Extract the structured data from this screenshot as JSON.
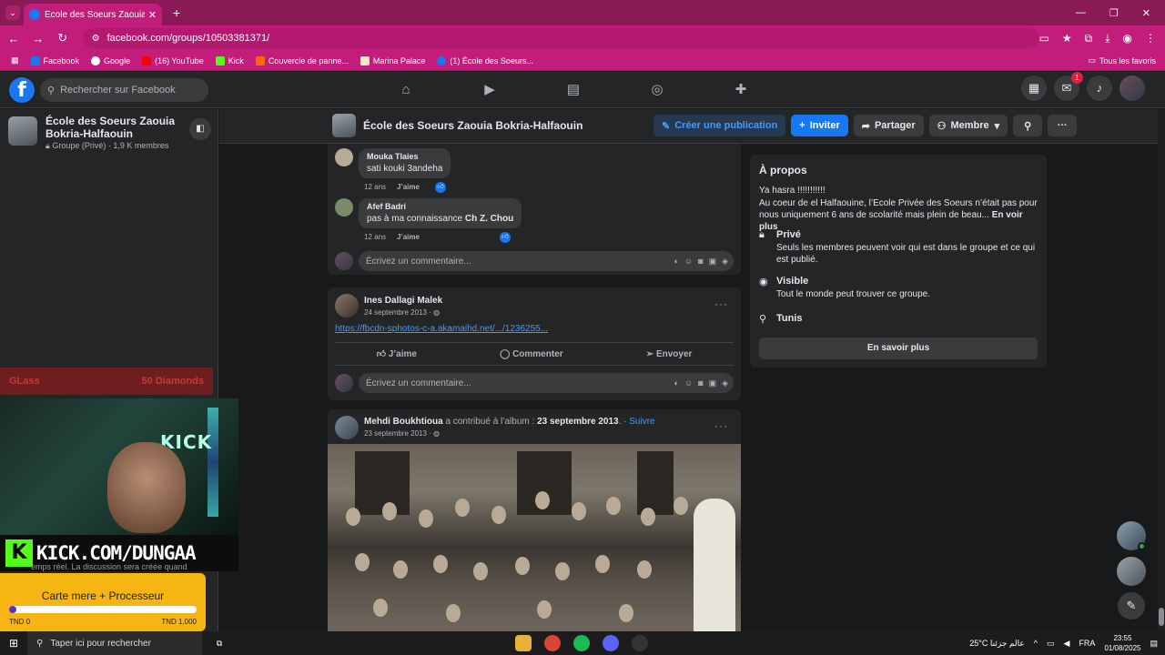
{
  "browser": {
    "tab_title": "École des Soeurs Zaouia Bokria",
    "tab_close": "✕",
    "new_tab": "+",
    "url": "facebook.com/groups/10503381371/",
    "bookmarks": [
      {
        "label": "Facebook",
        "color": "#1877f2"
      },
      {
        "label": "Google",
        "color": "#ffffff"
      },
      {
        "label": "(16) YouTube",
        "color": "#ff0000"
      },
      {
        "label": "Kick",
        "color": "#53fc18"
      },
      {
        "label": "Couvercle de panne...",
        "color": "#ff6600"
      },
      {
        "label": "Marina Palace",
        "color": "#f5e6c8"
      },
      {
        "label": "(1) École des Soeurs...",
        "color": "#1877f2"
      }
    ],
    "all_bookmarks": "Tous les favoris"
  },
  "facebook": {
    "search_placeholder": "Rechercher sur Facebook",
    "notifications_badge": "1"
  },
  "sidebar": {
    "group_name": "École des Soeurs Zaouia Bokria-Halfaouin",
    "group_meta": "Groupe (Privé) · 1,9 K membres"
  },
  "overlay": {
    "glass_label": "GLass",
    "glass_value": "50 Diamonds",
    "kick_url": "KICK.COM/DUNGAA",
    "kick_logo": "K",
    "webcam_sign": "KICK",
    "under_text": "emps réel. La discussion sera créée quand",
    "goal_title": "Carte mere + Processeur",
    "goal_min": "TND 0",
    "goal_max": "TND 1,000",
    "goal_progress_pct": 4
  },
  "group_header": {
    "title": "École des Soeurs Zaouia Bokria-Halfaouin",
    "create_post": "Créer une publication",
    "invite": "Inviter",
    "share": "Partager",
    "member": "Membre"
  },
  "comments": [
    {
      "author": "Mouka Tlaies",
      "text": "sati kouki 3andeha",
      "time": "12 ans",
      "like": "J’aime"
    },
    {
      "author": "Afef Badri",
      "text": "pas à ma connaissance",
      "mention": "Ch Z. Chou",
      "time": "12 ans",
      "like": "J’aime"
    }
  ],
  "write_comment_placeholder": "Écrivez un commentaire...",
  "posts": [
    {
      "author": "Ines Dallagi Malek",
      "date": "24 septembre 2013 · ",
      "link": "https://fbcdn-sphotos-c-a.akamaihd.net/.../1236255...",
      "like": "J’aime",
      "comment": "Commenter",
      "send": "Envoyer"
    },
    {
      "author": "Mehdi Boukhtioua",
      "contrib": " a contribué à l’album : ",
      "album": "23 septembre 2013",
      "dot": ". · ",
      "follow": "Suivre",
      "date": "23 septembre 2013 · "
    }
  ],
  "about": {
    "title": "À propos",
    "desc1": "Ya hasra !!!!!!!!!!!",
    "desc2": "Au coeur de el Halfaouine, l’Ecole Privée des Soeurs n’était pas pour nous uniquement 6 ans de scolarité mais plein de beau... ",
    "see_more": "En voir plus",
    "private_title": "Privé",
    "private_desc": "Seuls les membres peuvent voir qui est dans le groupe et ce qui est publié.",
    "visible_title": "Visible",
    "visible_desc": "Tout le monde peut trouver ce groupe.",
    "location": "Tunis",
    "learn_more": "En savoir plus"
  },
  "taskbar": {
    "search_placeholder": "Taper ici pour rechercher",
    "weather": "25°C  عالم جزئنا",
    "lang": "FRA",
    "time": "23:55",
    "date": "01/08/2025"
  }
}
